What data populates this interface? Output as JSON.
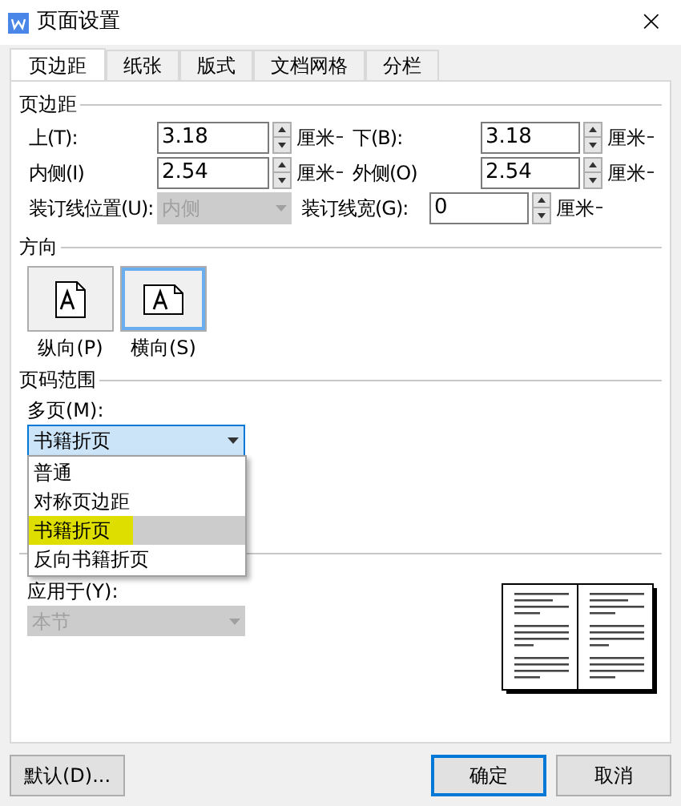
{
  "window": {
    "title": "页面设置",
    "close": "×"
  },
  "tabs": [
    {
      "label": "页边距",
      "selected": true
    },
    {
      "label": "纸张",
      "selected": false
    },
    {
      "label": "版式",
      "selected": false
    },
    {
      "label": "文档网格",
      "selected": false
    },
    {
      "label": "分栏",
      "selected": false
    }
  ],
  "margins": {
    "title": "页边距",
    "rows": [
      [
        {
          "label": "上(T):",
          "value": "3.18",
          "unit": "厘米",
          "kind": "spin"
        },
        {
          "label": "下(B):",
          "value": "3.18",
          "unit": "厘米",
          "kind": "spin"
        }
      ],
      [
        {
          "label": "内侧(I)",
          "value": "2.54",
          "unit": "厘米",
          "kind": "spin"
        },
        {
          "label": "外侧(O)",
          "value": "2.54",
          "unit": "厘米",
          "kind": "spin"
        }
      ],
      [
        {
          "label": "装订线位置(U):",
          "value": "内侧",
          "kind": "select",
          "disabled": true
        },
        {
          "label": "装订线宽(G):",
          "value": "0",
          "unit": "厘米",
          "kind": "spin"
        }
      ]
    ]
  },
  "orientation": {
    "title": "方向",
    "options": [
      {
        "label": "纵向(P)",
        "kind": "portrait",
        "selected": false
      },
      {
        "label": "横向(S)",
        "kind": "landscape",
        "selected": true
      }
    ]
  },
  "pages": {
    "title": "页码范围",
    "label": "多页(M):",
    "value": "书籍折页",
    "open": true,
    "options": [
      {
        "label": "普通",
        "selected": false,
        "highlighted": false
      },
      {
        "label": "对称页边距",
        "selected": false,
        "highlighted": false
      },
      {
        "label": "书籍折页",
        "selected": true,
        "highlighted": true
      },
      {
        "label": "反向书籍折页",
        "selected": false,
        "highlighted": false
      }
    ]
  },
  "preview": {
    "apply_label": "应用于(Y):",
    "apply_value": "本节",
    "apply_disabled": true
  },
  "buttons": [
    {
      "label": "默认(D)...",
      "kind": "default"
    },
    {
      "label": "确定",
      "kind": "primary"
    },
    {
      "label": "取消",
      "kind": "cancel"
    }
  ]
}
